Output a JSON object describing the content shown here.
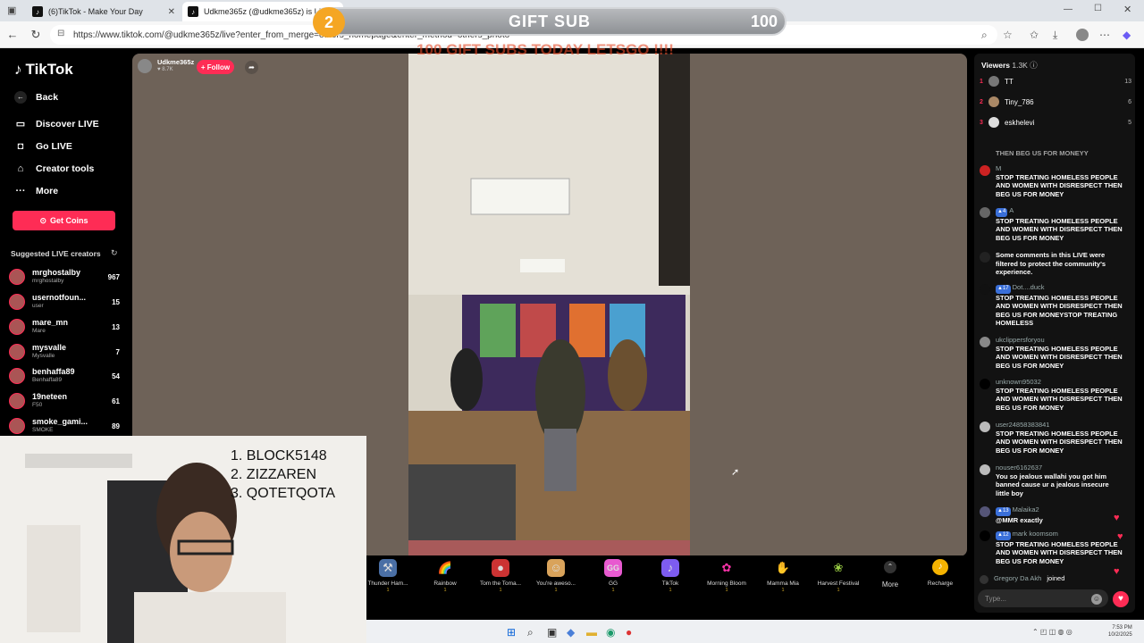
{
  "browser": {
    "tabs": [
      {
        "title": "(6)TikTok - Make Your Day"
      },
      {
        "title": "Udkme365z (@udkme365z) is LIVE"
      }
    ],
    "url": "https://www.tiktok.com/@udkme365z/live?enter_from_merge=others_homepage&enter_method=others_photo"
  },
  "overlay": {
    "gift_number": "2",
    "gift_title": "GIFT SUB",
    "gift_count": "100",
    "gift_subtext": "100 GIFT SUBS TODAY LETSGO !!!!"
  },
  "nav": {
    "logo": "TikTok",
    "back": "Back",
    "discover": "Discover LIVE",
    "golive": "Go LIVE",
    "creator_tools": "Creator tools",
    "more": "More",
    "get_coins": "Get Coins",
    "suggested_title": "Suggested LIVE creators",
    "creators": [
      {
        "name": "mrghostalby",
        "sub": "mrghostalby",
        "count": "967"
      },
      {
        "name": "usernotfoun...",
        "sub": "user",
        "count": "15"
      },
      {
        "name": "mare_mn",
        "sub": "Mare",
        "count": "13"
      },
      {
        "name": "mysvalle",
        "sub": "Mysvalle",
        "count": "7"
      },
      {
        "name": "benhaffa89",
        "sub": "Benhaffa89",
        "count": "54"
      },
      {
        "name": "19neteen",
        "sub": "F50",
        "count": "61"
      },
      {
        "name": "smoke_gami...",
        "sub": "SMOKE",
        "count": "89"
      }
    ]
  },
  "host": {
    "name": "Udkme365z",
    "likes": "8.7K",
    "follow": "+ Follow"
  },
  "gifts": [
    {
      "name": "Thunder Ham...",
      "price": "1"
    },
    {
      "name": "Rainbow",
      "price": "1"
    },
    {
      "name": "Tom the Toma...",
      "price": "1"
    },
    {
      "name": "You're aweso...",
      "price": "1"
    },
    {
      "name": "GG",
      "price": "1"
    },
    {
      "name": "TikTok",
      "price": "1"
    },
    {
      "name": "Morning Bloom",
      "price": "1"
    },
    {
      "name": "Mamma Mia",
      "price": "1"
    },
    {
      "name": "Harvest Festival",
      "price": "1"
    }
  ],
  "gift_more": "More",
  "recharge": "Recharge",
  "chat": {
    "viewers_label": "Viewers",
    "viewers_count": "1.3K",
    "top_viewers": [
      {
        "rank": "1",
        "name": "TT",
        "count": "13"
      },
      {
        "rank": "2",
        "name": "Tiny_786",
        "count": "6"
      },
      {
        "rank": "3",
        "name": "eskhelevi",
        "count": "5"
      }
    ],
    "partial_top": "THEN BEG US FOR MONEYY",
    "messages": [
      {
        "name": "M",
        "level": "",
        "text": "STOP TREATING HOMELESS PEOPLE AND WOMEN WITH DISRESPECT THEN BEG US FOR MONEY"
      },
      {
        "name": "A",
        "level": "4",
        "text": "STOP TREATING HOMELESS PEOPLE AND WOMEN WITH DISRESPECT THEN BEG US FOR MONEY"
      },
      {
        "name": "",
        "level": "",
        "text": "Some comments in this LIVE were filtered to protect the community's experience."
      },
      {
        "name": "Dot....duck",
        "level": "17",
        "text": "STOP TREATING HOMELESS PEOPLE AND WOMEN WITH DISRESPECT THEN BEG US FOR MONEYSTOP TREATING HOMELESS"
      },
      {
        "name": "ukclippersforyou",
        "level": "",
        "text": "STOP TREATING HOMELESS PEOPLE AND WOMEN WITH DISRESPECT THEN BEG US FOR MONEY"
      },
      {
        "name": "unknown95032",
        "level": "",
        "text": "STOP TREATING HOMELESS PEOPLE AND WOMEN WITH DISRESPECT THEN BEG US FOR MONEY"
      },
      {
        "name": "user24858383841",
        "level": "",
        "text": "STOP TREATING HOMELESS PEOPLE AND WOMEN WITH DISRESPECT THEN BEG US FOR MONEY"
      },
      {
        "name": "nouser6162637",
        "level": "",
        "text": "You so jealous wallahi you got him banned cause ur a jealous insecure little boy"
      },
      {
        "name": "Malaika2",
        "level": "13",
        "text": "@MMR exactly"
      },
      {
        "name": "mark koomsom",
        "level": "12",
        "text": "STOP TREATING HOMELESS PEOPLE AND WOMEN WITH DISRESPECT THEN BEG US FOR MONEY"
      }
    ],
    "joined_name": "Gregory Da Akh",
    "joined_text": "joined",
    "input_placeholder": "Type..."
  },
  "webcam": {
    "ranks": [
      "1. BLOCK5148",
      "2. ZIZZAREN",
      "3. QOTETQOTA"
    ]
  },
  "taskbar": {
    "time": "7:53 PM",
    "date": "10/2/2025"
  }
}
